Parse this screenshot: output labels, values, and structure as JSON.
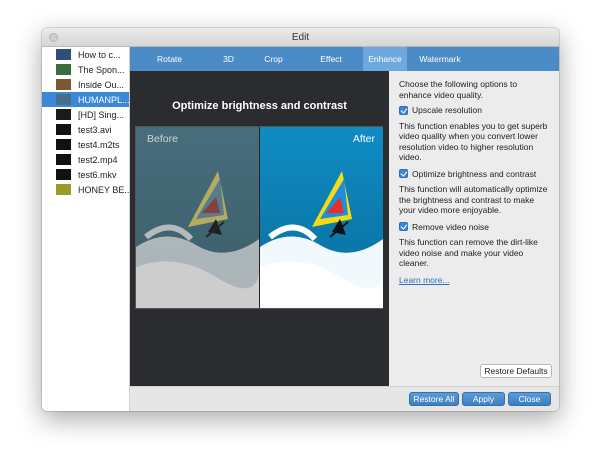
{
  "window": {
    "title": "Edit"
  },
  "files": [
    {
      "label": "How to c...",
      "thumb_color": "#2f4f7a"
    },
    {
      "label": "The Spon...",
      "thumb_color": "#3b6e3e"
    },
    {
      "label": "Inside Ou...",
      "thumb_color": "#7a5a2e"
    },
    {
      "label": "HUMANPL...",
      "thumb_color": "#4a6b8a",
      "selected": true
    },
    {
      "label": "[HD] Sing...",
      "thumb_color": "#1a1a1a"
    },
    {
      "label": "test3.avi",
      "thumb_color": "#111111"
    },
    {
      "label": "test4.m2ts",
      "thumb_color": "#111111"
    },
    {
      "label": "test2.mp4",
      "thumb_color": "#111111"
    },
    {
      "label": "test6.mkv",
      "thumb_color": "#111111"
    },
    {
      "label": "HONEY BE...",
      "thumb_color": "#9a9b2c"
    }
  ],
  "tabs": [
    {
      "label": "Rotate",
      "active": false
    },
    {
      "label": "3D",
      "active": false
    },
    {
      "label": "Crop",
      "active": false
    },
    {
      "label": "Effect",
      "active": false
    },
    {
      "label": "Enhance",
      "active": true
    },
    {
      "label": "Watermark",
      "active": false
    }
  ],
  "preview": {
    "title": "Optimize brightness and contrast",
    "before_label": "Before",
    "after_label": "After"
  },
  "options": {
    "intro": "Choose the following options to enhance video quality.",
    "items": [
      {
        "label": "Upscale resolution",
        "checked": true,
        "description": "This function enables you to get superb video quality when you convert lower resolution video to higher resolution video."
      },
      {
        "label": "Optimize brightness and contrast",
        "checked": true,
        "description": "This function will automatically optimize the brightness and contrast to make your video more enjoyable."
      },
      {
        "label": "Remove video noise",
        "checked": true,
        "description": "This function can remove the dirt-like video noise and make your video cleaner."
      }
    ],
    "learn_more": "Learn more..."
  },
  "buttons": {
    "restore_defaults": "Restore Defaults",
    "restore_all": "Restore All",
    "apply": "Apply",
    "close": "Close"
  },
  "colors": {
    "tab_bar": "#4b8bc6",
    "tab_active": "#6ea8df",
    "selection": "#3b88d6",
    "preview_bg": "#2b2c30"
  }
}
